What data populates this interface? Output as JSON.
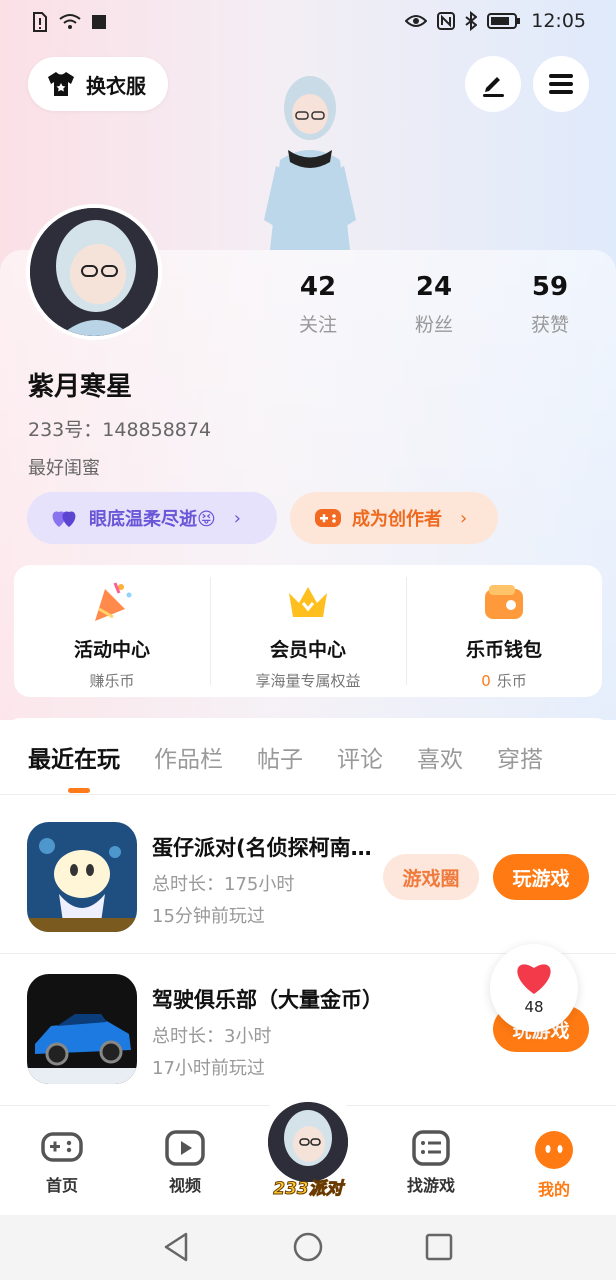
{
  "status_bar": {
    "time": "12:05"
  },
  "header": {
    "outfit_label": "换衣服"
  },
  "profile": {
    "stats": [
      {
        "value": "42",
        "label": "关注"
      },
      {
        "value": "24",
        "label": "粉丝"
      },
      {
        "value": "59",
        "label": "获赞"
      }
    ],
    "username": "紫月寒星",
    "uid": "233号：148858874",
    "bio": "最好闺蜜",
    "mood_label": "眼底温柔尽逝😝",
    "creator_label": "成为创作者"
  },
  "services": [
    {
      "title": "活动中心",
      "sub": "赚乐币"
    },
    {
      "title": "会员中心",
      "sub": "享海量专属权益"
    },
    {
      "title": "乐币钱包",
      "coin": "0",
      "sub": "乐币"
    }
  ],
  "tabs": [
    "最近在玩",
    "作品栏",
    "帖子",
    "评论",
    "喜欢",
    "穿搭"
  ],
  "games": [
    {
      "name": "蛋仔派对(名侦探柯南联动)",
      "duration": "总时长：175小时",
      "last_played": "15分钟前玩过",
      "circle_label": "游戏圈",
      "play_label": "玩游戏"
    },
    {
      "name": "驾驶俱乐部（大量金币）",
      "duration": "总时长：3小时",
      "last_played": "17小时前玩过",
      "play_label": "玩游戏"
    }
  ],
  "floating_like": {
    "count": "48"
  },
  "bottom_nav": {
    "items": [
      "首页",
      "视频",
      "找游戏",
      "我的"
    ],
    "center_label": "233派对"
  },
  "colors": {
    "accent": "#ff7a12",
    "mood": "#6a56d8"
  }
}
